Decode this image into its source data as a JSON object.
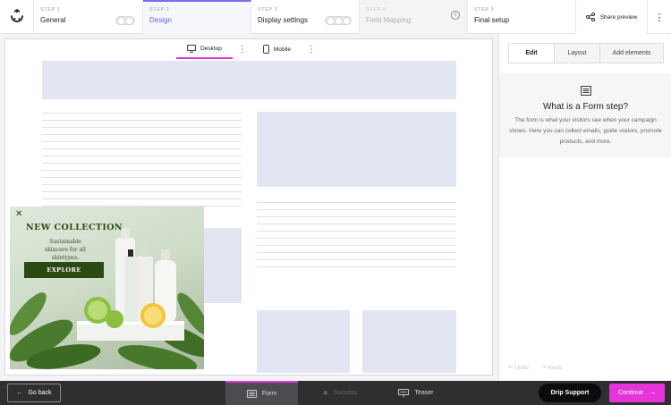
{
  "steps": [
    {
      "num": "STEP 1",
      "label": "General"
    },
    {
      "num": "STEP 2",
      "label": "Design"
    },
    {
      "num": "STEP 3",
      "label": "Display settings"
    },
    {
      "num": "STEP 4",
      "label": "Field Mapping"
    },
    {
      "num": "STEP 5",
      "label": "Final setup"
    }
  ],
  "header": {
    "share_label": "Share preview"
  },
  "canvas": {
    "desktop_label": "Desktop",
    "mobile_label": "Mobile"
  },
  "popup": {
    "title": "NEW COLLECTION",
    "subtitle": "Sustainable skincare for all skintypes.",
    "cta": "EXPLORE"
  },
  "panel": {
    "tabs": [
      "Edit",
      "Layout",
      "Add elements"
    ],
    "heading": "What is a Form step?",
    "description": "The form is what your visitors see when your campaign shows. Here you can collect emails, guide visitors, promote products, and more.",
    "undo_label": "Undo",
    "redo_label": "Redo"
  },
  "bottom": {
    "goback_label": "Go back",
    "tabs": [
      "Form",
      "Success",
      "Teaser"
    ],
    "drip_label": "Drip Support",
    "continue_label": "Continue"
  },
  "colors": {
    "accent": "#e535d8",
    "step_active": "#6b5ce7",
    "popup_button": "#2c4813"
  }
}
